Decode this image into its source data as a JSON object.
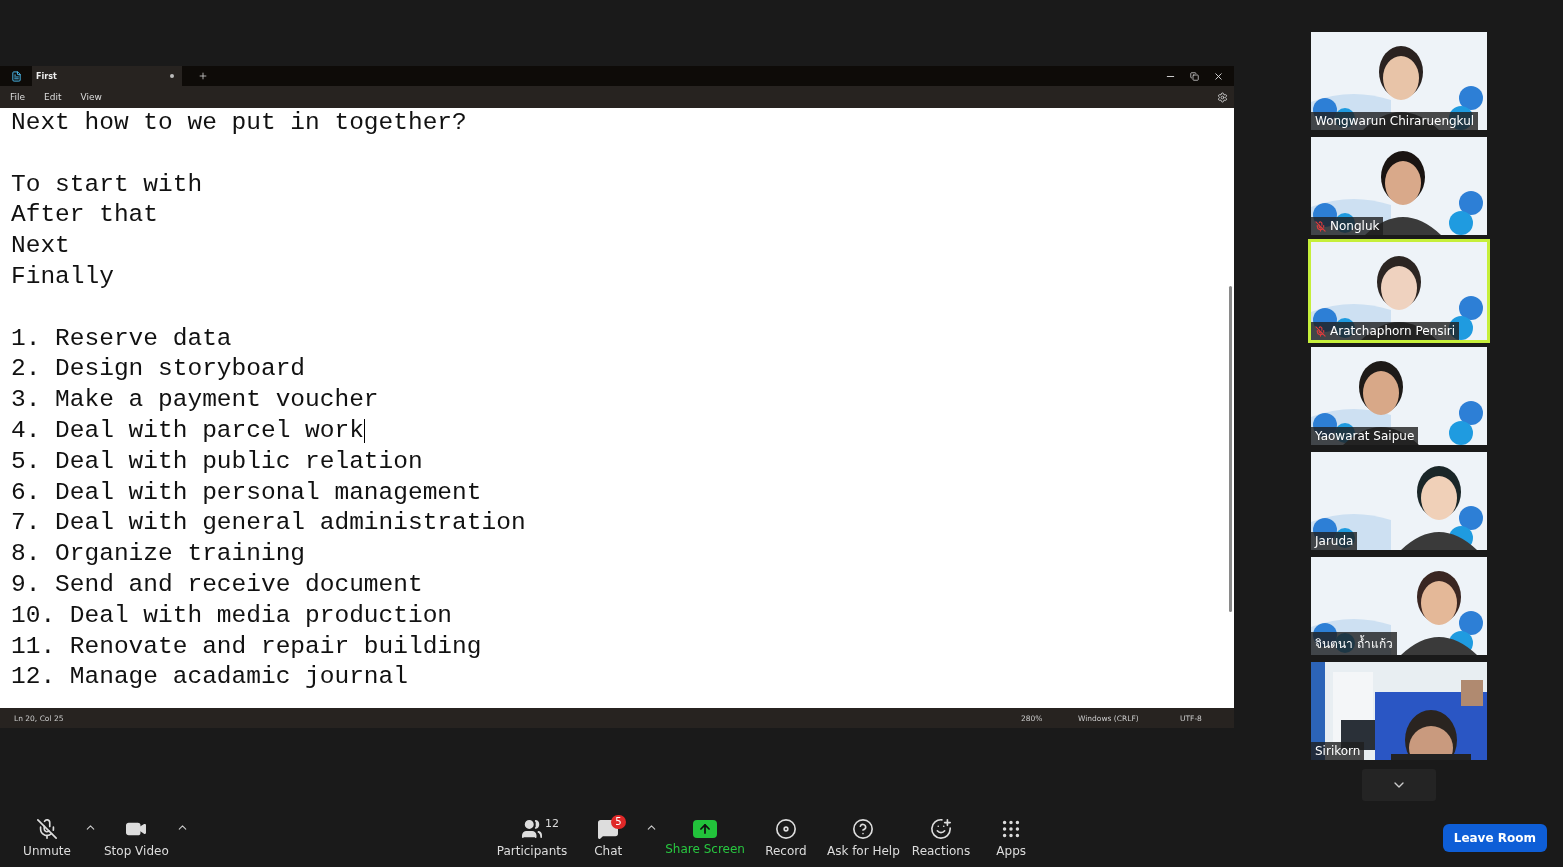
{
  "notepad": {
    "tab": {
      "title": "First",
      "unsaved": true
    },
    "menu": [
      "File",
      "Edit",
      "View"
    ],
    "lines": [
      {
        "kind": "text",
        "text": "Next how to we put in together?",
        "cursor": false
      },
      {
        "kind": "blank"
      },
      {
        "kind": "text",
        "text": "To start with",
        "cursor": false
      },
      {
        "kind": "text",
        "text": "After that",
        "cursor": false
      },
      {
        "kind": "text",
        "text": "Next",
        "cursor": false
      },
      {
        "kind": "text",
        "text": "Finally",
        "cursor": false
      },
      {
        "kind": "blank"
      },
      {
        "kind": "text",
        "text": "1. Reserve data",
        "cursor": false
      },
      {
        "kind": "text",
        "text": "2. Design storyboard",
        "cursor": false
      },
      {
        "kind": "text",
        "text": "3. Make a payment voucher",
        "cursor": false
      },
      {
        "kind": "text",
        "text": "4. Deal with parcel work",
        "cursor": true
      },
      {
        "kind": "text",
        "text": "5. Deal with public relation",
        "cursor": false
      },
      {
        "kind": "text",
        "text": "6. Deal with personal management",
        "cursor": false
      },
      {
        "kind": "text",
        "text": "7. Deal with general administration",
        "cursor": false
      },
      {
        "kind": "text",
        "text": "8. Organize training",
        "cursor": false
      },
      {
        "kind": "text",
        "text": "9. Send and receive document",
        "cursor": false
      },
      {
        "kind": "text",
        "text": "10. Deal with media production",
        "cursor": false
      },
      {
        "kind": "text",
        "text": "11. Renovate and repair building",
        "cursor": false
      },
      {
        "kind": "text",
        "text": "12. Manage acadamic journal",
        "cursor": false
      }
    ],
    "status_bar": {
      "position": "Ln 20, Col 25",
      "zoom": "280%",
      "line_ending": "Windows (CRLF)",
      "encoding": "UTF-8"
    }
  },
  "participants": [
    {
      "name": "Wongwarun Chiraruengkul",
      "muted": false,
      "speaking": false
    },
    {
      "name": "Nongluk",
      "muted": true,
      "speaking": false
    },
    {
      "name": "Aratchaphorn Pensiri",
      "muted": true,
      "speaking": true
    },
    {
      "name": "Yaowarat Saipue",
      "muted": false,
      "speaking": false
    },
    {
      "name": "Jaruda",
      "muted": false,
      "speaking": false
    },
    {
      "name": "จินตนา ถ้ำแก้ว",
      "muted": false,
      "speaking": false
    },
    {
      "name": "Sirikorn",
      "muted": false,
      "speaking": false
    }
  ],
  "toolbar": {
    "left": [
      {
        "kind": "mic",
        "label": "Unmute",
        "muted": true,
        "caret": true
      },
      {
        "kind": "video",
        "label": "Stop Video",
        "caret": true
      }
    ],
    "center": [
      {
        "kind": "participants",
        "label": "Participants",
        "count": "12",
        "caret": false
      },
      {
        "kind": "chat",
        "label": "Chat",
        "badge": "5",
        "caret": true
      },
      {
        "kind": "share",
        "label": "Share Screen",
        "caret": false
      },
      {
        "kind": "record",
        "label": "Record",
        "caret": false
      },
      {
        "kind": "help",
        "label": "Ask for Help",
        "caret": false
      },
      {
        "kind": "reactions",
        "label": "Reactions",
        "caret": false
      },
      {
        "kind": "apps",
        "label": "Apps",
        "caret": false
      }
    ],
    "leave_button": "Leave Room"
  }
}
